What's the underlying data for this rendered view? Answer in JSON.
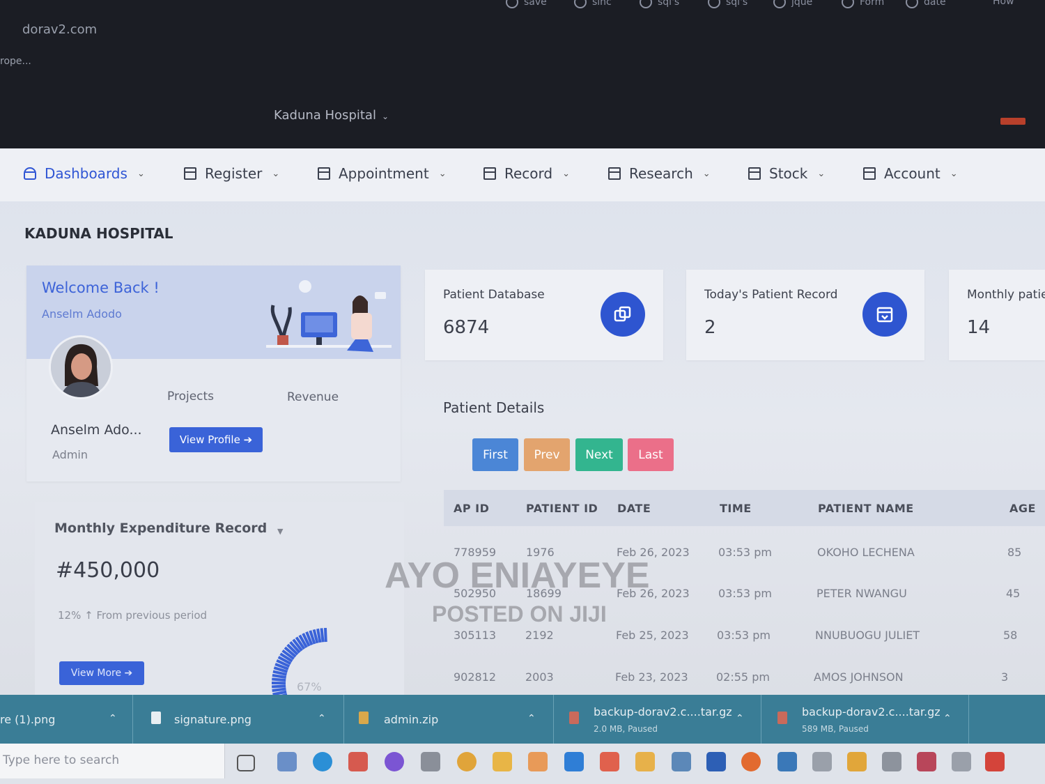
{
  "browser": {
    "bookmarks": [
      "save",
      "sinc",
      "sql's",
      "sql's",
      "jque",
      "Form",
      "date",
      "How"
    ],
    "url": "dorav2.com",
    "tab_text": "rope...",
    "hospital_selector": "Kaduna Hospital"
  },
  "nav": {
    "items": [
      {
        "label": "Dashboards"
      },
      {
        "label": "Register"
      },
      {
        "label": "Appointment"
      },
      {
        "label": "Record"
      },
      {
        "label": "Research"
      },
      {
        "label": "Stock"
      },
      {
        "label": "Account"
      }
    ]
  },
  "page": {
    "title": "KADUNA HOSPITAL"
  },
  "welcome": {
    "heading": "Welcome Back !",
    "subtitle": "Anselm Adodo",
    "projects_label": "Projects",
    "revenue_label": "Revenue",
    "name": "Anselm Ado...",
    "role": "Admin",
    "view_profile": "View Profile ➔"
  },
  "expenditure": {
    "title": "Monthly Expenditure Record",
    "amount": "#450,000",
    "change": "12% ↑   From previous period",
    "view_more": "View More ➔",
    "gauge_percent": "67%"
  },
  "stats": [
    {
      "label": "Patient Database",
      "value": "6874"
    },
    {
      "label": "Today's Patient Record",
      "value": "2"
    },
    {
      "label": "Monthly patie",
      "value": "14"
    }
  ],
  "patients": {
    "title": "Patient Details",
    "buttons": {
      "first": "First",
      "prev": "Prev",
      "next": "Next",
      "last": "Last"
    },
    "columns": [
      "AP ID",
      "PATIENT ID",
      "DATE",
      "TIME",
      "PATIENT NAME",
      "AGE"
    ],
    "rows": [
      [
        "778959",
        "1976",
        "Feb 26, 2023",
        "03:53 pm",
        "OKOHO   LECHENA",
        "85"
      ],
      [
        "502950",
        "18699",
        "Feb 26, 2023",
        "03:53 pm",
        "PETER   NWANGU",
        "45"
      ],
      [
        "305113",
        "2192",
        "Feb 25, 2023",
        "03:53 pm",
        "NNUBUOGU   JULIET",
        "58"
      ],
      [
        "902812",
        "2003",
        "Feb 23, 2023",
        "02:55 pm",
        "AMOS   JOHNSON",
        "3"
      ]
    ]
  },
  "watermark": {
    "line1": "AYO ENIAYEYE",
    "line2": "POSTED ON JIJI"
  },
  "downloads": [
    {
      "name": "re (1).png",
      "meta": ""
    },
    {
      "name": "signature.png",
      "meta": ""
    },
    {
      "name": "admin.zip",
      "meta": ""
    },
    {
      "name": "backup-dorav2.c....tar.gz",
      "meta": "2.0 MB, Paused"
    },
    {
      "name": "backup-dorav2.c....tar.gz",
      "meta": "589 MB, Paused"
    }
  ],
  "taskbar": {
    "search_placeholder": "Type here to search"
  },
  "colors": {
    "accent": "#2f55d4",
    "first": "#4b86d6",
    "prev": "#e3a46e",
    "next": "#33b58f",
    "last": "#eb6f89",
    "downloads_bar": "#3a7d96"
  }
}
